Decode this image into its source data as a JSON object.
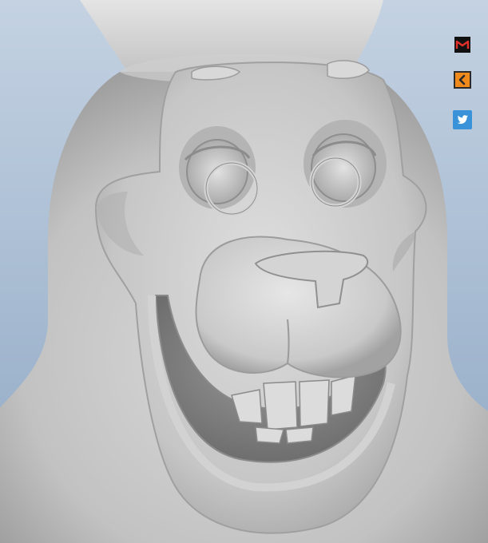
{
  "viewer": {
    "background_top": "#c4d2e2",
    "background_bottom": "#8fa8c4",
    "model_color": "#c8c8c8"
  },
  "toolbar": {
    "buttons": [
      {
        "name": "brand-logo-button",
        "icon": "m-logo-icon",
        "bg": "#111111",
        "fg": "#e0302a"
      },
      {
        "name": "collapse-panel-button",
        "icon": "chevron-left-icon",
        "bg": "#2b2b2b",
        "fg": "#f08a1c"
      },
      {
        "name": "twitter-share-button",
        "icon": "twitter-bird-icon",
        "bg": "#3a93d8",
        "fg": "#ffffff"
      }
    ]
  }
}
